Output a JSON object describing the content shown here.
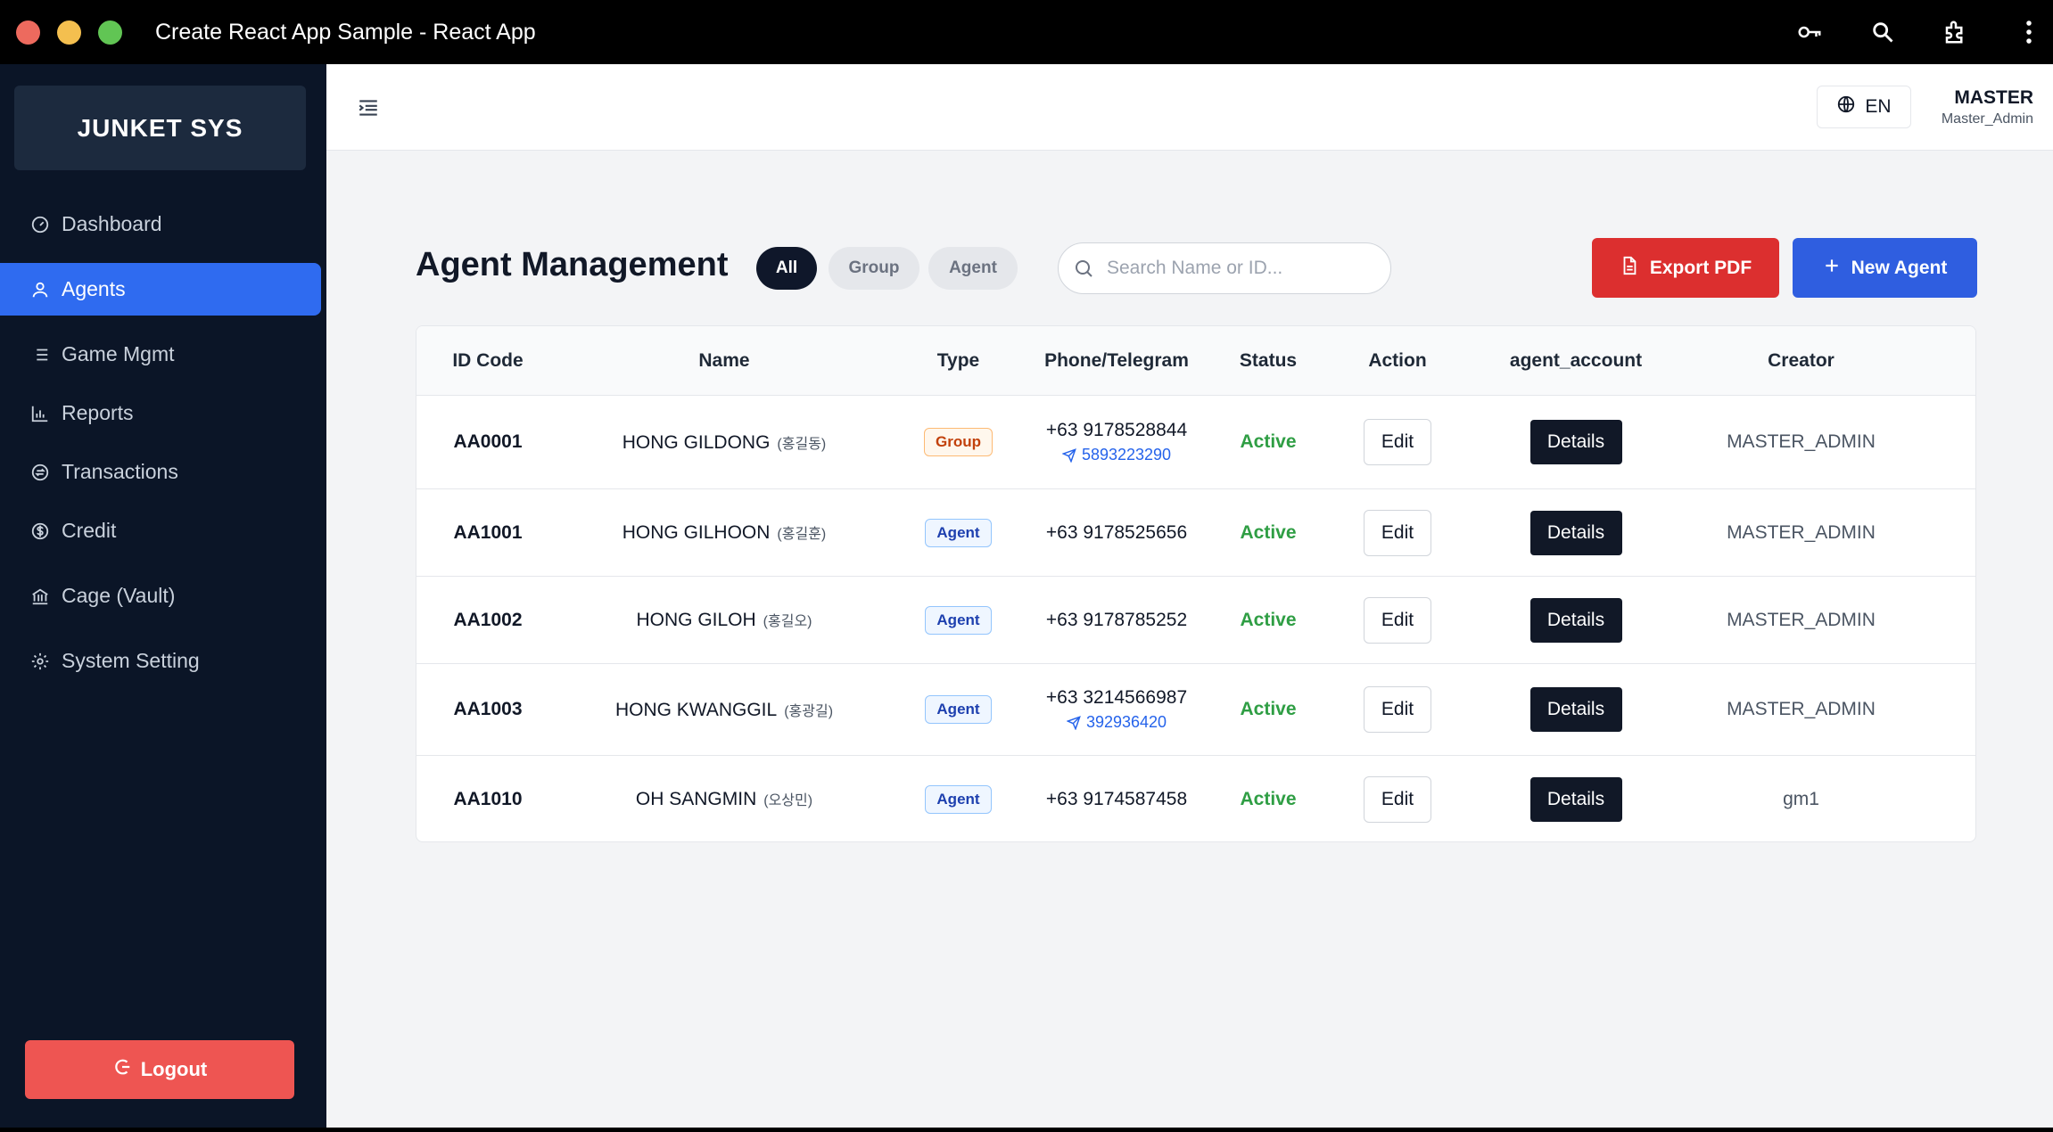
{
  "window": {
    "title": "Create React App Sample - React App"
  },
  "colors": {
    "sidebar_bg": "#0b1527",
    "accent": "#2f6bf0",
    "danger": "#dc2f2f",
    "logout": "#ee5552",
    "active_green": "#2f9e44"
  },
  "sidebar": {
    "brand": "JUNKET SYS",
    "items": [
      {
        "label": "Dashboard",
        "icon": "gauge-icon",
        "active": false
      },
      {
        "label": "Agents",
        "icon": "user-icon",
        "active": true
      },
      {
        "label": "Game Mgmt",
        "icon": "list-icon",
        "active": false
      },
      {
        "label": "Reports",
        "icon": "bar-chart-icon",
        "active": false
      },
      {
        "label": "Transactions",
        "icon": "exchange-icon",
        "active": false
      },
      {
        "label": "Credit",
        "icon": "dollar-circle-icon",
        "active": false
      },
      {
        "label": "Cage (Vault)",
        "icon": "bank-icon",
        "active": false
      },
      {
        "label": "System Setting",
        "icon": "gear-icon",
        "active": false
      }
    ],
    "logout_label": "Logout"
  },
  "header": {
    "language": "EN",
    "user_name": "MASTER",
    "user_role": "Master_Admin"
  },
  "page": {
    "title": "Agent Management",
    "filters": [
      "All",
      "Group",
      "Agent"
    ],
    "active_filter": "All",
    "search_placeholder": "Search Name or ID...",
    "export_label": "Export PDF",
    "new_label": "New Agent"
  },
  "table": {
    "columns": [
      "ID Code",
      "Name",
      "Type",
      "Phone/Telegram",
      "Status",
      "Action",
      "agent_account",
      "Creator"
    ],
    "edit_label": "Edit",
    "details_label": "Details",
    "rows": [
      {
        "id": "AA0001",
        "name": "HONG GILDONG",
        "kor": "(홍길동)",
        "type": "Group",
        "phone": "+63 9178528844",
        "telegram": "5893223290",
        "status": "Active",
        "creator": "MASTER_ADMIN"
      },
      {
        "id": "AA1001",
        "name": "HONG GILHOON",
        "kor": "(홍길훈)",
        "type": "Agent",
        "phone": "+63 9178525656",
        "telegram": "",
        "status": "Active",
        "creator": "MASTER_ADMIN"
      },
      {
        "id": "AA1002",
        "name": "HONG GILOH",
        "kor": "(홍길오)",
        "type": "Agent",
        "phone": "+63 9178785252",
        "telegram": "",
        "status": "Active",
        "creator": "MASTER_ADMIN"
      },
      {
        "id": "AA1003",
        "name": "HONG KWANGGIL",
        "kor": "(홍광길)",
        "type": "Agent",
        "phone": "+63 3214566987",
        "telegram": "392936420",
        "status": "Active",
        "creator": "MASTER_ADMIN"
      },
      {
        "id": "AA1010",
        "name": "OH SANGMIN",
        "kor": "(오상민)",
        "type": "Agent",
        "phone": "+63 9174587458",
        "telegram": "",
        "status": "Active",
        "creator": "gm1"
      }
    ]
  }
}
